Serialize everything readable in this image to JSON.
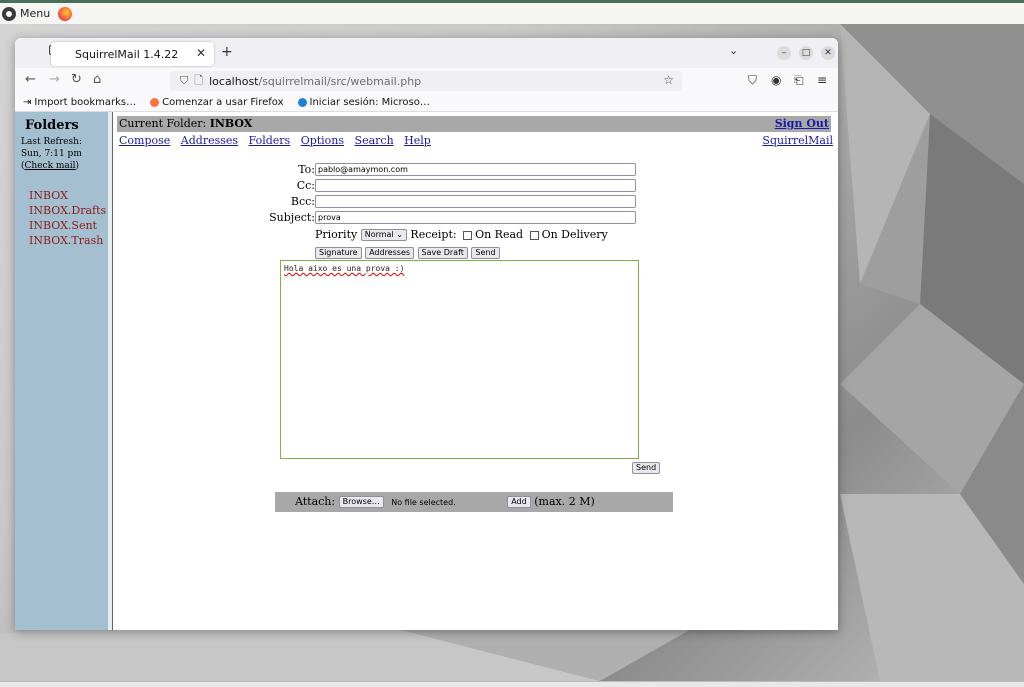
{
  "topbar": {
    "menu_label": "Menu"
  },
  "browser": {
    "tab_title": "SquirrelMail 1.4.22",
    "url_host": "localhost",
    "url_path": "/squirrelmail/src/webmail.php",
    "bookmarks": [
      {
        "label": "Import bookmarks…"
      },
      {
        "label": "Comenzar a usar Firefox"
      },
      {
        "label": "Iniciar sesión: Microso…"
      }
    ]
  },
  "sidebar": {
    "title": "Folders",
    "last_refresh_label": "Last Refresh:",
    "last_refresh_time": "Sun, 7:11 pm",
    "check_mail": "Check mail",
    "folders": [
      "INBOX",
      "INBOX.Drafts",
      "INBOX.Sent",
      "INBOX.Trash"
    ]
  },
  "header": {
    "current_folder_label": "Current Folder:",
    "current_folder": "INBOX",
    "sign_out": "Sign Out",
    "links": [
      "Compose",
      "Addresses",
      "Folders",
      "Options",
      "Search",
      "Help"
    ],
    "brand": "SquirrelMail"
  },
  "compose": {
    "to_label": "To:",
    "to_value": "pablo@amaymon.com",
    "cc_label": "Cc:",
    "cc_value": "",
    "bcc_label": "Bcc:",
    "bcc_value": "",
    "subject_label": "Subject:",
    "subject_value": "prova",
    "priority_label": "Priority",
    "priority_value": "Normal",
    "receipt_label": "Receipt:",
    "on_read": "On Read",
    "on_delivery": "On Delivery",
    "buttons": [
      "Signature",
      "Addresses",
      "Save Draft",
      "Send"
    ],
    "body": "Hola aixo es una prova :)",
    "send_bottom": "Send"
  },
  "attach": {
    "label": "Attach:",
    "browse": "Browse…",
    "no_file": "No file selected.",
    "add": "Add",
    "max": "(max. 2 M)"
  }
}
